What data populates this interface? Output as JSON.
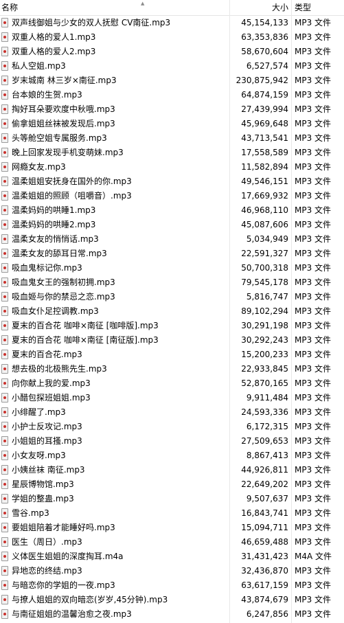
{
  "header": {
    "name": "名称",
    "size": "大小",
    "type": "类型"
  },
  "files": [
    {
      "name": "双声线御姐与少女的双人抚慰 CV南征.mp3",
      "size": "45,154,133",
      "type": "MP3 文件"
    },
    {
      "name": "双重人格的爱人1.mp3",
      "size": "63,353,836",
      "type": "MP3 文件"
    },
    {
      "name": "双重人格的爱人2.mp3",
      "size": "58,670,604",
      "type": "MP3 文件"
    },
    {
      "name": "私人空姐.mp3",
      "size": "6,527,574",
      "type": "MP3 文件"
    },
    {
      "name": "岁末城南 林三岁×南征.mp3",
      "size": "230,875,942",
      "type": "MP3 文件"
    },
    {
      "name": "台本娘的生贺.mp3",
      "size": "64,874,159",
      "type": "MP3 文件"
    },
    {
      "name": "掏好耳朵要欢度中秋哦.mp3",
      "size": "27,439,994",
      "type": "MP3 文件"
    },
    {
      "name": "偷拿姐姐丝袜被发现后.mp3",
      "size": "45,969,648",
      "type": "MP3 文件"
    },
    {
      "name": "头等舱空姐专属服务.mp3",
      "size": "43,713,541",
      "type": "MP3 文件"
    },
    {
      "name": "晚上回家发现手机变萌妹.mp3",
      "size": "17,558,589",
      "type": "MP3 文件"
    },
    {
      "name": "网瘾女友.mp3",
      "size": "11,582,894",
      "type": "MP3 文件"
    },
    {
      "name": "温柔姐姐安抚身在国外的你.mp3",
      "size": "49,546,151",
      "type": "MP3 文件"
    },
    {
      "name": "温柔姐姐的照顾（咀嚼音）.mp3",
      "size": "17,669,932",
      "type": "MP3 文件"
    },
    {
      "name": "温柔妈妈的哄睡1.mp3",
      "size": "46,968,110",
      "type": "MP3 文件"
    },
    {
      "name": "温柔妈妈的哄睡2.mp3",
      "size": "45,087,606",
      "type": "MP3 文件"
    },
    {
      "name": "温柔女友的悄悄话.mp3",
      "size": "5,034,949",
      "type": "MP3 文件"
    },
    {
      "name": "温柔女友的舔耳日常.mp3",
      "size": "22,591,327",
      "type": "MP3 文件"
    },
    {
      "name": "吸血鬼标记你.mp3",
      "size": "50,700,318",
      "type": "MP3 文件"
    },
    {
      "name": "吸血鬼女王的强制初拥.mp3",
      "size": "79,545,178",
      "type": "MP3 文件"
    },
    {
      "name": "吸血姬与你的禁忌之恋.mp3",
      "size": "5,816,747",
      "type": "MP3 文件"
    },
    {
      "name": "吸血女仆足控调教.mp3",
      "size": "89,102,294",
      "type": "MP3 文件"
    },
    {
      "name": "夏末的百合花 咖啡×南征 [咖啡版].mp3",
      "size": "30,291,198",
      "type": "MP3 文件"
    },
    {
      "name": "夏末的百合花 咖啡×南征 [南征版].mp3",
      "size": "30,292,243",
      "type": "MP3 文件"
    },
    {
      "name": "夏末的百合花.mp3",
      "size": "15,200,233",
      "type": "MP3 文件"
    },
    {
      "name": "想去极的北极熊先生.mp3",
      "size": "22,933,845",
      "type": "MP3 文件"
    },
    {
      "name": "向你献上我的爱.mp3",
      "size": "52,870,165",
      "type": "MP3 文件"
    },
    {
      "name": "小醋包探班姐姐.mp3",
      "size": "9,911,484",
      "type": "MP3 文件"
    },
    {
      "name": "小绯醒了.mp3",
      "size": "24,593,336",
      "type": "MP3 文件"
    },
    {
      "name": "小护士反攻记.mp3",
      "size": "6,172,315",
      "type": "MP3 文件"
    },
    {
      "name": "小姐姐的耳搔.mp3",
      "size": "27,509,653",
      "type": "MP3 文件"
    },
    {
      "name": "小女友呀.mp3",
      "size": "8,867,413",
      "type": "MP3 文件"
    },
    {
      "name": "小姨丝袜 南征.mp3",
      "size": "44,926,811",
      "type": "MP3 文件"
    },
    {
      "name": "星辰博物馆.mp3",
      "size": "22,649,202",
      "type": "MP3 文件"
    },
    {
      "name": "学姐的整蛊.mp3",
      "size": "9,507,637",
      "type": "MP3 文件"
    },
    {
      "name": "雪谷.mp3",
      "size": "16,843,741",
      "type": "MP3 文件"
    },
    {
      "name": "要姐姐陪着才能睡好吗.mp3",
      "size": "15,094,711",
      "type": "MP3 文件"
    },
    {
      "name": "医生（周日）.mp3",
      "size": "46,659,488",
      "type": "MP3 文件"
    },
    {
      "name": "义体医生姐姐的深度掏耳.m4a",
      "size": "31,431,423",
      "type": "M4A 文件"
    },
    {
      "name": "异地恋的终结.mp3",
      "size": "32,436,870",
      "type": "MP3 文件"
    },
    {
      "name": "与暗恋你的学姐的一夜.mp3",
      "size": "63,617,159",
      "type": "MP3 文件"
    },
    {
      "name": "与撩人姐姐的双向暗恋(岁岁,45分钟).mp3",
      "size": "43,874,679",
      "type": "MP3 文件"
    },
    {
      "name": "与南征姐姐的温馨治愈之夜.mp3",
      "size": "6,247,856",
      "type": "MP3 文件"
    }
  ]
}
